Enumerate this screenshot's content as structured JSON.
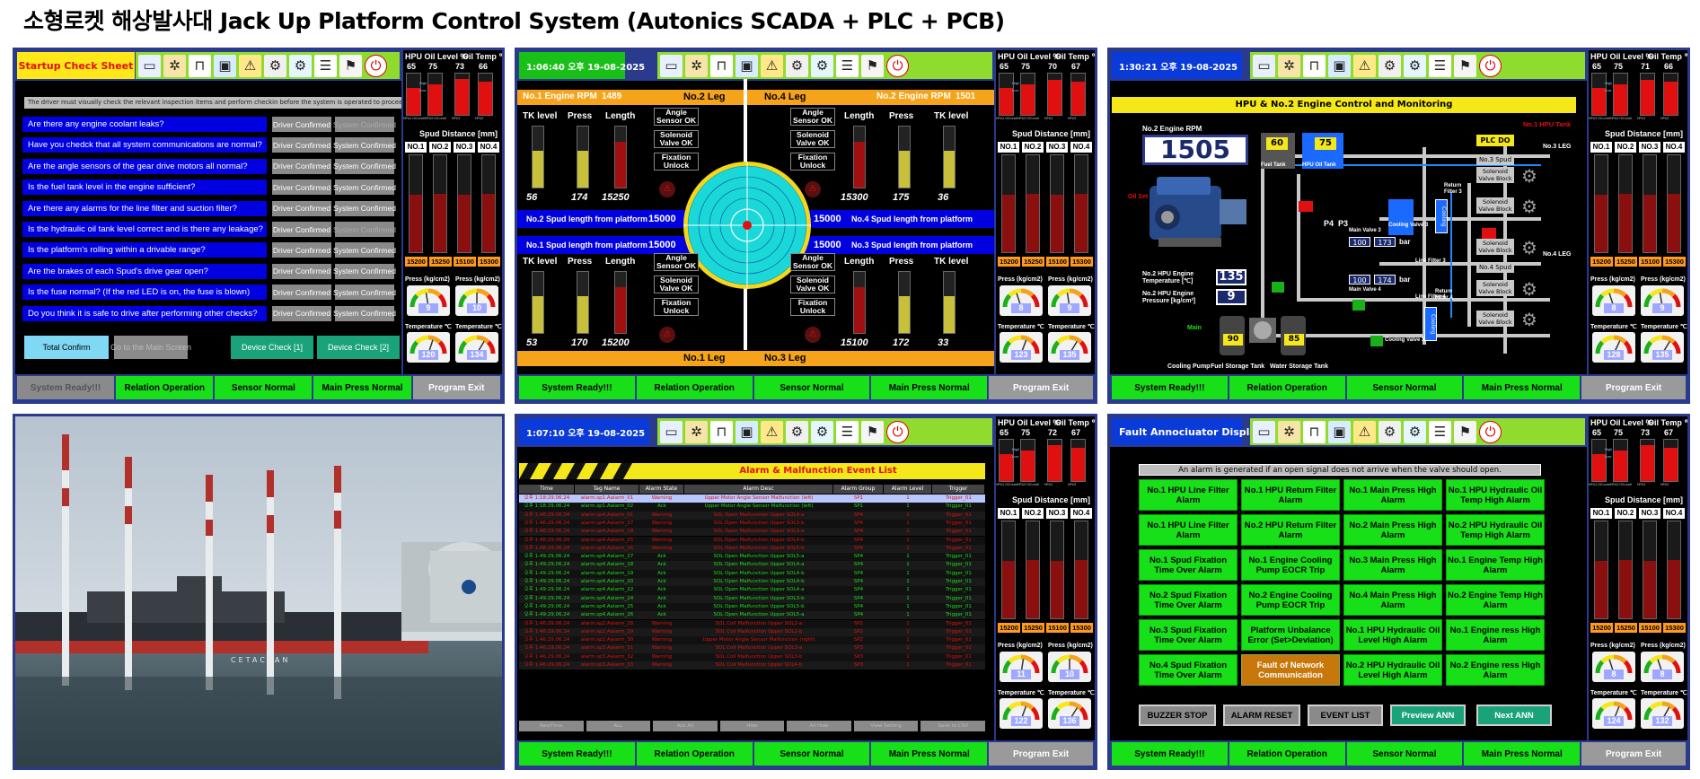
{
  "page_title": "소형로켓 해상발사대 Jack Up Platform Control System (Autonics SCADA + PLC + PCB)",
  "colors": {
    "frame": "#2a3a8c",
    "ok_green": "#18e018",
    "icon_bar": "#8fdc2f",
    "question_blue": "#0000e0",
    "alarm_red": "#e01010"
  },
  "toolbar_icons": [
    "monitor-icon",
    "gear-joint-icon",
    "rig-icon",
    "computer-icon",
    "warning-leg-icon",
    "settings-person-icon",
    "gear-icon",
    "document-icon",
    "alarm-light-icon",
    "power-exit-icon"
  ],
  "bottom_bar": {
    "ready": "System Ready!!!",
    "relation": "Relation Operation",
    "sensor": "Sensor Normal",
    "press": "Main Press Normal",
    "exit": "Program Exit"
  },
  "side": {
    "hpu_oil_label": "HPU Oil Level %",
    "oil_temp_label": "Oil Temp ℃",
    "spud_label": "Spud Distance [mm]",
    "spud_headers": [
      "NO.1",
      "NO.2",
      "NO.3",
      "NO.4"
    ],
    "press_label": "Press (kg/cm2)",
    "temp_label": "Temperature ℃",
    "level_sub": [
      "HPU1 Oil Level",
      "HPU2 Oil Level",
      "HPU1",
      "HPU2"
    ],
    "hi_label": "High",
    "lo_label": "Low"
  },
  "sides": [
    {
      "oil": [
        "65",
        "75"
      ],
      "temp": [
        "73",
        "66"
      ],
      "spud": [
        "15200",
        "15250",
        "15100",
        "15300"
      ],
      "press": [
        "9",
        "10"
      ],
      "temps": [
        "120",
        "134"
      ]
    },
    {
      "oil": [
        "65",
        "75"
      ],
      "temp": [
        "70",
        "67"
      ],
      "spud": [
        "15200",
        "15250",
        "15100",
        "15300"
      ],
      "press": [
        "8",
        "9"
      ],
      "temps": [
        "123",
        "135"
      ]
    },
    {
      "oil": [
        "65",
        "75"
      ],
      "temp": [
        "71",
        "66"
      ],
      "spud": [
        "15200",
        "15250",
        "15100",
        "15300"
      ],
      "press": [
        "8",
        "9"
      ],
      "temps": [
        "128",
        "135"
      ]
    },
    {
      "oil": [
        "65",
        "75"
      ],
      "temp": [
        "72",
        "67"
      ],
      "spud": [
        "15200",
        "15250",
        "15100",
        "15300"
      ],
      "press": [
        "11",
        "10"
      ],
      "temps": [
        "122",
        "136"
      ]
    },
    {
      "oil": [
        "65",
        "75"
      ],
      "temp": [
        "73",
        "67"
      ],
      "spud": [
        "15200",
        "15250",
        "15100",
        "15300"
      ],
      "press": [
        "8",
        "8"
      ],
      "temps": [
        "124",
        "132"
      ]
    }
  ],
  "p1": {
    "header": "Startup Check Sheet",
    "note": "The driver must visually check the relevant inspection items and perform checkin before the system is operated to proceed to the main screen.",
    "questions": [
      "Are there any engine coolant leaks?",
      "Have you chedck that all system communications are normal?",
      "Are the angle sensors of the gear drive motors all normal?",
      "Is the fuel tank level in the engine sufficient?",
      "Are there any alarms for the line filter and suction filter?",
      "Is the hydraulic oil tank level correct and is there any leakage?",
      "Is the platform's rolling within a drivable range?",
      "Are the brakes of each Spud's drive gear open?",
      "Is the fuse normal? (If the red LED is on, the fuse is blown)",
      "Do you think it is safe to drive after performing other checks?"
    ],
    "driver_label": "Driver Confirmed",
    "system_label": "System Confirmed",
    "total_confirm": "Total Confirm",
    "goto_main": "Go to the Main Screen",
    "device1": "Device Check [1]",
    "device2": "Device Check [2]"
  },
  "p2": {
    "time": "1:06:40 오후 19-08-2025",
    "leg_tl": "No.2 Leg",
    "leg_tr": "No.4 Leg",
    "leg_bl": "No.1 Leg",
    "leg_br": "No.3 Leg",
    "rpm1_label": "No.1 Engine RPM",
    "rpm1": "1489",
    "rpm2_label": "No.2 Engine RPM",
    "rpm2": "1501",
    "col_tk": "TK level",
    "col_press": "Press",
    "col_len": "Length",
    "tl_vals": [
      "56",
      "174",
      "15250"
    ],
    "tr_vals": [
      "15300",
      "175",
      "36"
    ],
    "bl_vals": [
      "53",
      "170",
      "15200"
    ],
    "br_vals": [
      "15100",
      "172",
      "33"
    ],
    "sensors": [
      "Angle Sensor OK",
      "Solenoid Valve OK",
      "Fixation Unlock"
    ],
    "spud2_label": "No.2 Spud length from platform",
    "spud2": "15000",
    "spud1_label": "No.1 Spud length from platform",
    "spud1": "15000",
    "spud4_label": "No.4 Spud length from platform",
    "spud4": "15000",
    "spud3_label": "No.3 Spud length from platform",
    "spud3": "15000"
  },
  "p3": {
    "time": "1:30:21 오후 19-08-2025",
    "banner": "HPU & No.2 Engine Control and Monitoring",
    "rpm_label": "No.2 Engine RPM",
    "rpm": "1505",
    "hpu_tank_label": "No.1 HPU Tank",
    "fuel_tank": "Fuel Tank",
    "hpu_oil_tank": "HPU Oil Tank",
    "fuel_val": "60",
    "oil_val": "75",
    "plc": "PLC DO",
    "leg3": "No.3 LEG",
    "leg4": "No.4 LEG",
    "spud3": "No.3 Spud",
    "spud4": "No.4 Spud",
    "solenoid": "Solenoid Valve Block",
    "temp_label": "No.2 HPU Engine Temperature [℃]",
    "temp_val": "135",
    "press_label": "No.2 HPU Engine Pressure [kg/cm²]",
    "press_val": "9",
    "main_valve3": "Main Valve 3",
    "main_valve4": "Main Valve 4",
    "mv3_a": "100",
    "mv3_b": "173",
    "mv4_a": "100",
    "mv4_b": "174",
    "bar": "bar",
    "cooling_valve3": "Cooling Valve 3",
    "line_filter3": "Line Filter 3",
    "line_filter4": "Line Filter 4",
    "return_filter3": "Return Filter 3",
    "return_filter4": "Return Filter 4",
    "cooling": "Cooling",
    "cooling_pump": "Cooling Pump",
    "fuel_storage": "Fuel Storage Tank",
    "water_storage": "Water Storage Tank",
    "fs_val": "90",
    "ws_val": "85",
    "p4": "P4",
    "p3": "P3",
    "oilset": "Oil Set",
    "main": "Main"
  },
  "p5": {
    "time": "1:07:10 오후 19-08-2025",
    "banner": "Alarm & Malfunction Event List",
    "headers": [
      "Time",
      "Tag Name",
      "Alarm State",
      "Alarm Desc",
      "Alarm Group",
      "Alarm Level",
      "Trigger"
    ],
    "rows": [
      [
        "오후 1:18:29.06.24",
        "alarm.sp1.Aalarm_01",
        "Warning",
        "Upper Motor Angle Sensor Malfunction (left)",
        "SP1",
        "1",
        "Trigger_01"
      ],
      [
        "오후 1:18:29.06.24",
        "alarm.sp1.Aalarm_02",
        "Ack",
        "Upper Motor Angle Sensor Malfunction (left)",
        "SP1",
        "1",
        "Trigger_01"
      ],
      [
        "오후 1:46:29.06.24",
        "alarm.sp4.Aalarm_01",
        "Warning",
        "SOL Open Malfunction Upper SOL4-a",
        "SP4",
        "1",
        "Trigger_01"
      ],
      [
        "오후 1:46:29.06.24",
        "alarm.sp4.Aalarm_27",
        "Warning",
        "SOL Open Malfunction Upper SOL3-b",
        "SP4",
        "1",
        "Trigger_01"
      ],
      [
        "오후 1:46:29.06.24",
        "alarm.sp4.Aalarm_18",
        "Warning",
        "SOL Open Malfunction Upper SOL3-a",
        "SP4",
        "1",
        "Trigger_01"
      ],
      [
        "오후 1:46:29.06.24",
        "alarm.sp4.Aalarm_25",
        "Warning",
        "SOL Open Malfunction Upper SOL4-b",
        "SP4",
        "1",
        "Trigger_01"
      ],
      [
        "오후 1:46:29.06.24",
        "alarm.sp4.Aalarm_26",
        "Warning",
        "SOL Open Malfunction Upper SOL5-b",
        "SP4",
        "1",
        "Trigger_01"
      ],
      [
        "오후 1:49:29.06.24",
        "alarm.sp4.Aalarm_27",
        "Ack",
        "SOL Open Malfunction Upper SOL5-a",
        "SP4",
        "1",
        "Trigger_01"
      ],
      [
        "오후 1:49:29.06.24",
        "alarm.sp4.Aalarm_18",
        "Ack",
        "SOL Open Malfunction Upper SOL4-a",
        "SP4",
        "1",
        "Trigger_01"
      ],
      [
        "오후 1:49:29.06.24",
        "alarm.sp4.Aalarm_19",
        "Ack",
        "SOL Open Malfunction Upper SOL4-b",
        "SP4",
        "1",
        "Trigger_01"
      ],
      [
        "오후 1:49:29.06.24",
        "alarm.sp4.Aalarm_20",
        "Ack",
        "SOL Open Malfunction Upper SOL4-b",
        "SP4",
        "1",
        "Trigger_01"
      ],
      [
        "오후 1:49:29.06.24",
        "alarm.sp4.Aalarm_22",
        "Ack",
        "SOL Open Malfunction Upper SOL4-a",
        "SP4",
        "1",
        "Trigger_01"
      ],
      [
        "오후 1:49:29.06.24",
        "alarm.sp4.Aalarm_24",
        "Ack",
        "SOL Open Malfunction Upper SOL3-b",
        "SP4",
        "1",
        "Trigger_01"
      ],
      [
        "오후 1:49:29.06.24",
        "alarm.sp4.Aalarm_25",
        "Ack",
        "SOL Open Malfunction Upper SOL5-b",
        "SP4",
        "1",
        "Trigger_01"
      ],
      [
        "오후 1:49:29.06.24",
        "alarm.sp4.Aalarm_26",
        "Ack",
        "SOL Open Malfunction Upper SOL5-a",
        "SP4",
        "1",
        "Trigger_01"
      ],
      [
        "오후 1:46:29.06.24",
        "alarm.sp2.Aalarm_28",
        "Warning",
        "SOL Coil Malfunction Upper SOL2-a",
        "SP2",
        "1",
        "Trigger_01"
      ],
      [
        "오후 1:46:29.06.24",
        "alarm.sp2.Aalarm_29",
        "Warning",
        "SOL Coil Malfunction Upper SOL2-b",
        "SP2",
        "1",
        "Trigger_01"
      ],
      [
        "오후 1:46:29.06.24",
        "alarm.sp2.Aalarm_30",
        "Warning",
        "Upper Motor Angle Sensor Malfunction (right)",
        "SP2",
        "1",
        "Trigger_01"
      ],
      [
        "오후 1:46:29.06.24",
        "alarm.sp3.Aalarm_31",
        "Warning",
        "SOL Coil Malfunction Upper SOL3-a",
        "SP3",
        "1",
        "Trigger_01"
      ],
      [
        "오후 1:46:29.06.24",
        "alarm.sp3.Aalarm_32",
        "Warning",
        "SOL Coil Malfunction Upper SOL3-b",
        "SP3",
        "1",
        "Trigger_01"
      ],
      [
        "오후 1:46:29.06.24",
        "alarm.sp3.Aalarm_33",
        "Warning",
        "SOL Coil Malfunction Upper SOL4-b",
        "SP3",
        "1",
        "Trigger_01"
      ]
    ],
    "footer_buttons": [
      "NewTime",
      "ALL",
      "Ack All",
      "Hide",
      "All Hide",
      "View Setting",
      "Save to CSV"
    ]
  },
  "p6": {
    "header": "Fault Annociuator Display",
    "note": "An alarm is generated if an open signal does not arrive when the valve should open.",
    "alarms": [
      "No.1 HPU Line Filter Alarm",
      "No.1 HPU Return Filter Alarm",
      "No.1 Main Press High Alarm",
      "No.1 HPU Hydraulic Oil Temp High Alarm",
      "No.1 HPU Line Filter Alarm",
      "No.2 HPU Return Filter Alarm",
      "No.2 Main Press High Alarm",
      "No.2 HPU Hydraulic Oil Temp High Alarm",
      "No.1 Spud Fixation Time Over Alarm",
      "No.1 Engine Cooling Pump EOCR Trip",
      "No.3 Main Press High Alarm",
      "No.1 Engine Temp High Alarm",
      "No.2 Spud Fixation Time Over Alarm",
      "No.2 Engine Cooling Pump EOCR Trip",
      "No.4 Main Press High Alarm",
      "No.2 Engine Temp High Alarm",
      "No.3 Spud Fixation Time Over Alarm",
      "Platform Unbalance Error (Set>Deviation)",
      "No.1 HPU Hydraulic Oil Level High Alarm",
      "No.1 Engine ress High Alarm",
      "No.4 Spud Fixation Time Over Alarm",
      "Fault of Network Communication",
      "No.2 HPU Hydraulic Oil Level High Alarm",
      "No.2 Engine ress High Alarm"
    ],
    "buzzer": "BUZZER STOP",
    "reset": "ALARM RESET",
    "event": "EVENT LIST",
    "prev": "Preview ANN",
    "next": "Next ANN"
  },
  "photo": {
    "hull_text": "CETACEAN"
  }
}
